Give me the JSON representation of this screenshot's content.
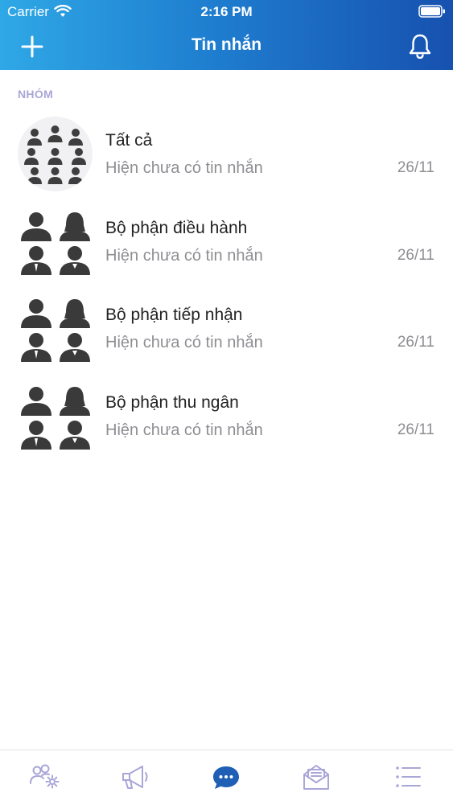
{
  "status_bar": {
    "carrier": "Carrier",
    "time": "2:16 PM"
  },
  "nav": {
    "title": "Tin nhắn",
    "add_icon": "plus-icon",
    "bell_icon": "bell-icon"
  },
  "section": {
    "title": "NHÓM"
  },
  "groups": [
    {
      "name": "Tất cả",
      "preview": "Hiện chưa có tin nhắn",
      "date": "26/11",
      "avatar": "group-all-avatar"
    },
    {
      "name": "Bộ phận điều hành",
      "preview": "Hiện chưa có tin nhắn",
      "date": "26/11",
      "avatar": "group-avatar"
    },
    {
      "name": "Bộ phận tiếp nhận",
      "preview": "Hiện chưa có tin nhắn",
      "date": "26/11",
      "avatar": "group-avatar"
    },
    {
      "name": "Bộ phận thu ngân",
      "preview": "Hiện chưa có tin nhắn",
      "date": "26/11",
      "avatar": "group-avatar"
    }
  ],
  "tabs": [
    {
      "icon": "users-settings-icon",
      "active": false
    },
    {
      "icon": "megaphone-icon",
      "active": false
    },
    {
      "icon": "chat-bubble-icon",
      "active": true
    },
    {
      "icon": "mail-open-icon",
      "active": false
    },
    {
      "icon": "list-icon",
      "active": false
    }
  ],
  "colors": {
    "accent": "#1751b0",
    "header_start": "#2fa8e6",
    "section_title": "#a9a6d8",
    "tab_inactive": "#a9a6d8",
    "tab_active": "#1f5fb5"
  }
}
